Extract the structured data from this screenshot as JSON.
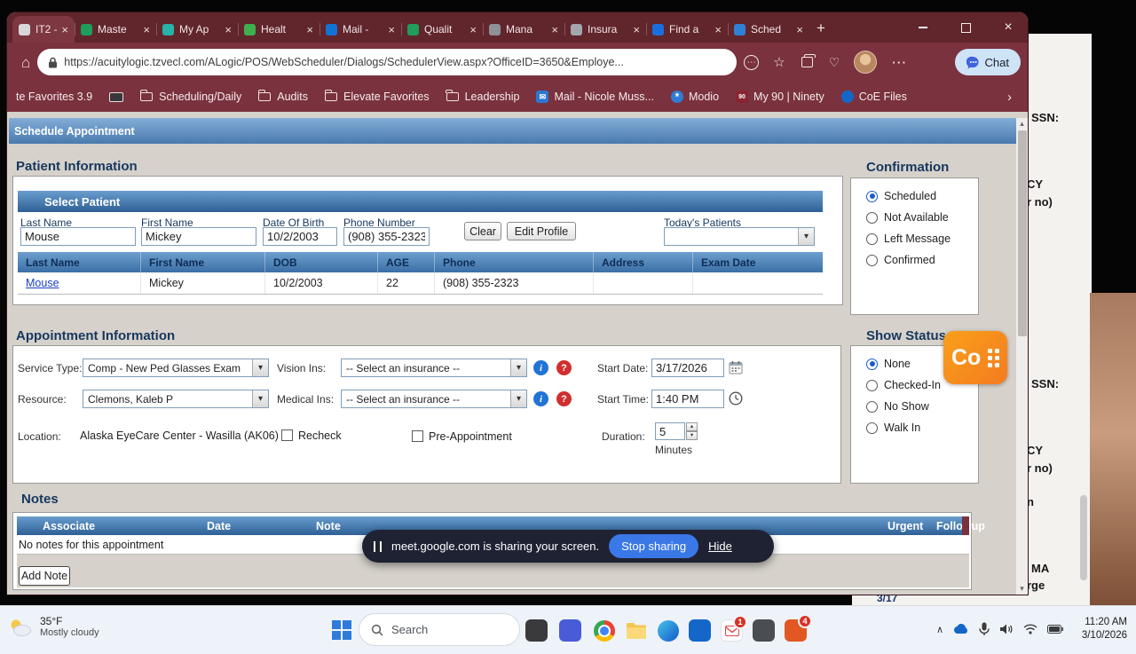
{
  "colors": {
    "browser_theme": "#7a323e",
    "tabstrip": "#61252c",
    "header_blue": "#4a7aae",
    "section_heading": "#17375e",
    "selected_radio_blue": "#1b5cc8",
    "accent_orange": "#f7941d",
    "share_button_blue": "#3b78e7",
    "link_blue": "#1a3fc4"
  },
  "browser": {
    "tabs": [
      {
        "label": "IT2 - P",
        "color": "#d8d8d8"
      },
      {
        "label": "Maste",
        "color": "#1e9e5a"
      },
      {
        "label": "My Ap",
        "color": "#27b3a8"
      },
      {
        "label": "Healt",
        "color": "#3faf4e"
      },
      {
        "label": "Mail -",
        "color": "#1273d4"
      },
      {
        "label": "Qualit",
        "color": "#1e9e5a"
      },
      {
        "label": "Mana",
        "color": "#8e9296"
      },
      {
        "label": "Insura",
        "color": "#a3a7ab"
      },
      {
        "label": "Find a",
        "color": "#1a6fe0"
      },
      {
        "label": "Sched",
        "color": "#2f81d6"
      }
    ],
    "address": {
      "url": "https://acuitylogic.tzvecl.com/ALogic/POS/WebScheduler/Dialogs/SchedulerView.aspx?OfficeID=3650&Employe...",
      "chat_label": "Chat"
    },
    "bookmarks": [
      {
        "label": "te Favorites 3.9"
      },
      {
        "label": "Scheduling/Daily"
      },
      {
        "label": "Audits"
      },
      {
        "label": "Elevate Favorites"
      },
      {
        "label": "Leadership"
      },
      {
        "label": "Mail - Nicole Muss...",
        "color": "#2a77d4"
      },
      {
        "label": "Modio",
        "color": "#2e7cd6"
      },
      {
        "label": "My 90 | Ninety",
        "color": "#8a2432"
      },
      {
        "label": "CoE Files",
        "color": "#1467c8"
      }
    ]
  },
  "scheduler": {
    "title": "Schedule Appointment",
    "patient": {
      "heading": "Patient Information",
      "select_patient": "Select Patient",
      "fields": {
        "last_name_label": "Last Name",
        "last_name": "Mouse",
        "first_name_label": "First Name",
        "first_name": "Mickey",
        "dob_label": "Date Of Birth",
        "dob": "10/2/2003",
        "phone_label": "Phone Number",
        "phone": "(908) 355-2323"
      },
      "clear_button": "Clear",
      "edit_profile_button": "Edit Profile",
      "todays_patients_label": "Today's Patients",
      "todays_patients_value": "",
      "table": {
        "headers": [
          "Last Name",
          "First Name",
          "DOB",
          "AGE",
          "Phone",
          "Address",
          "Exam Date"
        ],
        "rows": [
          [
            "Mouse",
            "Mickey",
            "10/2/2003",
            "22",
            "(908) 355-2323",
            "",
            ""
          ]
        ]
      }
    },
    "confirmation": {
      "heading": "Confirmation",
      "options": [
        {
          "label": "Scheduled",
          "selected": true
        },
        {
          "label": "Not Available",
          "selected": false
        },
        {
          "label": "Left Message",
          "selected": false
        },
        {
          "label": "Confirmed",
          "selected": false
        }
      ]
    },
    "appointment": {
      "heading": "Appointment Information",
      "service_type_label": "Service Type:",
      "service_type": "Comp - New Ped Glasses Exam",
      "resource_label": "Resource:",
      "resource": "Clemons, Kaleb P",
      "location_label": "Location:",
      "location": "Alaska EyeCare Center - Wasilla (AK06)",
      "vision_ins_label": "Vision Ins:",
      "vision_ins": "-- Select an insurance --",
      "medical_ins_label": "Medical Ins:",
      "medical_ins": "-- Select an insurance --",
      "recheck_label": "Recheck",
      "recheck_checked": false,
      "pre_appointment_label": "Pre-Appointment",
      "pre_appointment_checked": false,
      "start_date_label": "Start Date:",
      "start_date": "3/17/2026",
      "start_time_label": "Start Time:",
      "start_time": "1:40 PM",
      "duration_label": "Duration:",
      "duration": "5",
      "duration_unit": "Minutes"
    },
    "show_status": {
      "heading": "Show Status",
      "options": [
        {
          "label": "None",
          "selected": true
        },
        {
          "label": "Checked-In",
          "selected": false
        },
        {
          "label": "No Show",
          "selected": false
        },
        {
          "label": "Walk In",
          "selected": false
        }
      ]
    },
    "notes": {
      "heading": "Notes",
      "headers": [
        "Associate",
        "Date",
        "Note",
        "Urgent",
        "Followup"
      ],
      "empty_text": "No notes for this appointment",
      "add_note_button": "Add Note"
    }
  },
  "share_banner": {
    "message": "meet.google.com is sharing your screen.",
    "stop_button": "Stop sharing",
    "hide_button": "Hide"
  },
  "side_badge": {
    "text": "Co"
  },
  "background_window": {
    "fragments": [
      "SSN:",
      "CY",
      "r no)",
      "SSN:",
      "CY",
      "r no)",
      "n",
      "MA",
      "rge",
      "3/17"
    ]
  },
  "taskbar": {
    "weather_temp": "35°F",
    "weather_desc": "Mostly cloudy",
    "search_placeholder": "Search",
    "mail_badge": "1",
    "app_badge": "4",
    "time": "11:20 AM",
    "date": "3/10/2026"
  }
}
